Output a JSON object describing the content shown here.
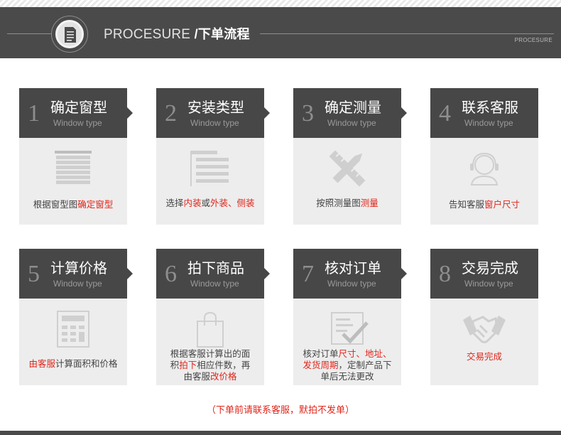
{
  "header": {
    "title_en": "PROCESURE",
    "title_cn": "/下单流程",
    "small_tag": "PROCESURE",
    "icon": "document-icon"
  },
  "steps": [
    {
      "num": "1",
      "name": "确定窗型",
      "sub": "Window type",
      "icon": "blinds-icon",
      "desc": [
        {
          "t": "根据窗型图",
          "red": false
        },
        {
          "t": "确定窗型",
          "red": true
        }
      ]
    },
    {
      "num": "2",
      "name": "安装类型",
      "sub": "Window type",
      "icon": "list-icon",
      "desc": [
        {
          "t": "选择",
          "red": false
        },
        {
          "t": "内装",
          "red": true
        },
        {
          "t": "或",
          "red": false
        },
        {
          "t": "外装、侧装",
          "red": true
        }
      ]
    },
    {
      "num": "3",
      "name": "确定测量",
      "sub": "Window type",
      "icon": "ruler-pencil-icon",
      "desc": [
        {
          "t": "按照测量图",
          "red": false
        },
        {
          "t": "测量",
          "red": true
        }
      ]
    },
    {
      "num": "4",
      "name": "联系客服",
      "sub": "Window type",
      "icon": "headset-icon",
      "desc": [
        {
          "t": "告知客服",
          "red": false
        },
        {
          "t": "窗户尺寸",
          "red": true
        }
      ]
    },
    {
      "num": "5",
      "name": "计算价格",
      "sub": "Window type",
      "icon": "calculator-icon",
      "desc": [
        {
          "t": "由客服",
          "red": true
        },
        {
          "t": "计算面积和价格",
          "red": false
        }
      ]
    },
    {
      "num": "6",
      "name": "拍下商品",
      "sub": "Window type",
      "icon": "shopping-bag-icon",
      "desc": [
        {
          "t": "根据客服计算出的面积",
          "red": false
        },
        {
          "t": "拍下",
          "red": true
        },
        {
          "t": "相应件数，再由客服",
          "red": false
        },
        {
          "t": "改价格",
          "red": true
        }
      ]
    },
    {
      "num": "7",
      "name": "核对订单",
      "sub": "Window type",
      "icon": "checklist-icon",
      "desc": [
        {
          "t": "核对订单",
          "red": false
        },
        {
          "t": "尺寸、地址、发货周期",
          "red": true
        },
        {
          "t": "，定制产品下单后无法更改",
          "red": false
        }
      ]
    },
    {
      "num": "8",
      "name": "交易完成",
      "sub": "Window type",
      "icon": "handshake-icon",
      "desc": [
        {
          "t": "交易完成",
          "red": true
        }
      ]
    }
  ],
  "note": "（下单前请联系客服，默拍不发单）",
  "colors": {
    "accent_red": "#e0251a",
    "header_dark": "#474747",
    "card_bg": "#ededed"
  }
}
